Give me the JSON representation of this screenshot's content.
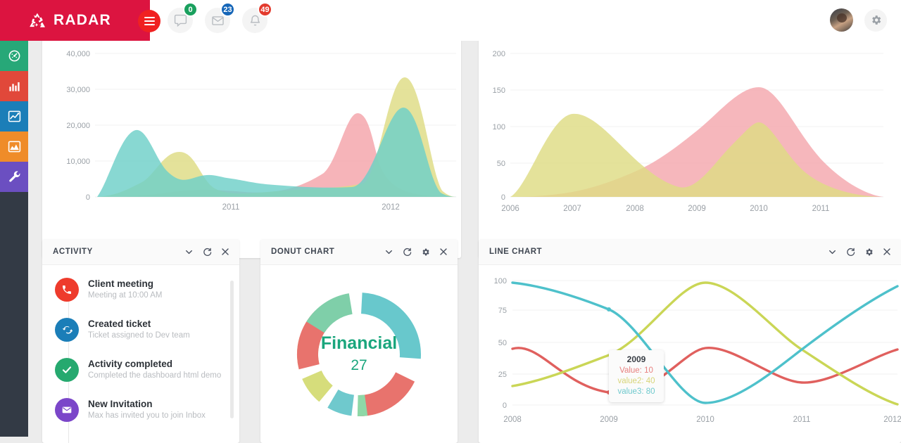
{
  "header": {
    "brand": "RADAR",
    "brand_icon": "recycle-icon",
    "menu_icon": "hamburger-icon",
    "icons": [
      {
        "name": "comment-icon",
        "badge": "0",
        "badge_color": "#1aa05e"
      },
      {
        "name": "envelope-icon",
        "badge": "23",
        "badge_color": "#1666b8"
      },
      {
        "name": "bell-icon",
        "badge": "49",
        "badge_color": "#e33b2e"
      }
    ],
    "avatar_name": "user-avatar",
    "settings_icon": "gear-icon",
    "brand_bg": "#dc1440"
  },
  "sidebar": {
    "items": [
      {
        "name": "dashboard",
        "icon": "speedometer-icon",
        "color": "#27a878"
      },
      {
        "name": "bar-charts",
        "icon": "bar-chart-icon",
        "color": "#e1483a"
      },
      {
        "name": "line-charts",
        "icon": "line-chart-icon",
        "color": "#1b7eb8"
      },
      {
        "name": "area-charts",
        "icon": "area-chart-icon",
        "color": "#ef8c29"
      },
      {
        "name": "tools",
        "icon": "wrench-icon",
        "color": "#6b4fc1"
      }
    ]
  },
  "panels": {
    "activity": {
      "title": "ACTIVITY",
      "tools": [
        "chevron-down-icon",
        "refresh-icon",
        "close-icon"
      ],
      "items": [
        {
          "title": "Client meeting",
          "sub": "Meeting at 10:00 AM",
          "icon": "phone-icon",
          "color": "#ee3b2c"
        },
        {
          "title": "Created ticket",
          "sub": "Ticket assigned to Dev team",
          "icon": "refresh-icon",
          "color": "#1b7eb8"
        },
        {
          "title": "Activity completed",
          "sub": "Completed the dashboard html demo",
          "icon": "check-icon",
          "color": "#26a96f"
        },
        {
          "title": "New Invitation",
          "sub": "Max has invited you to join Inbox",
          "icon": "envelope-icon",
          "color": "#7b46c9"
        }
      ]
    },
    "donut": {
      "title": "DONUT CHART",
      "tools": [
        "chevron-down-icon",
        "refresh-icon",
        "gear-icon",
        "close-icon"
      ]
    },
    "line": {
      "title": "LINE CHART",
      "tools": [
        "chevron-down-icon",
        "refresh-icon",
        "gear-icon",
        "close-icon"
      ]
    }
  },
  "chart_data": [
    {
      "id": "area-top-left",
      "type": "area",
      "title": "",
      "xlabel": "",
      "ylabel": "",
      "x": [
        2010.5,
        2011,
        2011.5,
        2012,
        2012.5
      ],
      "tick_labels": [
        "2011",
        "2012"
      ],
      "ylim": [
        0,
        40000
      ],
      "yticks": [
        0,
        10000,
        20000,
        30000,
        40000
      ],
      "ytick_labels": [
        "0",
        "10,000",
        "20,000",
        "30,000",
        "40,000"
      ],
      "grid": true,
      "legend": "none",
      "series": [
        {
          "name": "series1",
          "color": "#6ed0c8",
          "values": [
            0,
            18300,
            5300,
            4400,
            22500,
            0
          ]
        },
        {
          "name": "series2",
          "color": "#dedc84",
          "values": [
            0,
            2500,
            12700,
            4000,
            32400,
            0
          ]
        },
        {
          "name": "series3",
          "color": "#f4a7ad",
          "values": [
            0,
            500,
            900,
            6200,
            25800,
            0
          ]
        }
      ]
    },
    {
      "id": "area-top-right",
      "type": "area",
      "title": "",
      "xlabel": "",
      "ylabel": "",
      "categories": [
        2006,
        2007,
        2008,
        2009,
        2010,
        2011
      ],
      "tick_labels": [
        "2006",
        "2007",
        "2008",
        "2009",
        "2010",
        "2011"
      ],
      "ylim": [
        0,
        200
      ],
      "yticks": [
        0,
        50,
        100,
        150,
        200
      ],
      "ytick_labels": [
        "0",
        "50",
        "100",
        "150",
        "200"
      ],
      "grid": true,
      "legend": "none",
      "series": [
        {
          "name": "series1",
          "color": "#dedc84",
          "values": [
            0,
            112,
            52,
            28,
            90,
            20,
            0
          ]
        },
        {
          "name": "series2",
          "color": "#f4a7ad",
          "values": [
            0,
            10,
            40,
            85,
            152,
            60,
            0
          ]
        }
      ]
    },
    {
      "id": "donut",
      "type": "pie",
      "title": "Financial",
      "center_value": "27",
      "center_color": "#1aa67d",
      "values": [
        25,
        8,
        18,
        3,
        8,
        8,
        16,
        14
      ],
      "colors": [
        "#68c8cc",
        "#d6dd7b",
        "#e8736d",
        "#8ed8a7",
        "#6fc9cd",
        "#d6dd7b",
        "#e8736d",
        "#7fcfa9"
      ],
      "legend": "none"
    },
    {
      "id": "line-chart",
      "type": "line",
      "title": "",
      "xlabel": "",
      "ylabel": "",
      "categories": [
        2008,
        2009,
        2010,
        2011,
        2012
      ],
      "tick_labels": [
        "2008",
        "2009",
        "2010",
        "2011",
        "2012"
      ],
      "ylim": [
        0,
        100
      ],
      "yticks": [
        0,
        25,
        50,
        75,
        100
      ],
      "ytick_labels": [
        "0",
        "25",
        "50",
        "75",
        "100"
      ],
      "grid": true,
      "legend": "none",
      "series": [
        {
          "name": "Value",
          "color": "#e0605e",
          "values": [
            45,
            10,
            45,
            32,
            45
          ]
        },
        {
          "name": "value2",
          "color": "#cad656",
          "values": [
            15,
            40,
            95,
            50,
            2
          ]
        },
        {
          "name": "value3",
          "color": "#4ec1cb",
          "values": [
            95,
            80,
            3,
            50,
            92
          ]
        }
      ],
      "tooltip": {
        "x": "2009",
        "rows": [
          {
            "label": "Value: 10",
            "color": "#e8807f"
          },
          {
            "label": "value2: 40",
            "color": "#d8d57a"
          },
          {
            "label": "value3: 80",
            "color": "#6fc9cd"
          }
        ]
      }
    }
  ]
}
